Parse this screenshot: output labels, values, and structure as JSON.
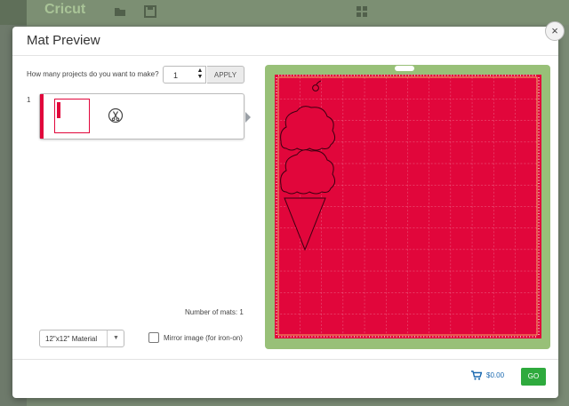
{
  "app": {
    "logo": "Cricut"
  },
  "modal": {
    "title": "Mat Preview",
    "close_glyph": "×"
  },
  "project": {
    "question": "How many projects do you want to make?",
    "quantity": "1",
    "apply_label": "APPLY"
  },
  "mats": [
    {
      "index": "1",
      "icon": "scissors-cut-icon"
    }
  ],
  "summary": {
    "number_of_mats_label": "Number of mats:  1"
  },
  "material": {
    "selected": "12\"x12\" Material"
  },
  "mirror": {
    "label": "Mirror image (for iron-on)",
    "checked": false
  },
  "footer": {
    "price": "$0.00",
    "go_label": "GO"
  },
  "colors": {
    "mat": "#e1063b",
    "mat_frame": "#98c078",
    "go": "#2eaa3d",
    "price": "#1a69b0"
  }
}
